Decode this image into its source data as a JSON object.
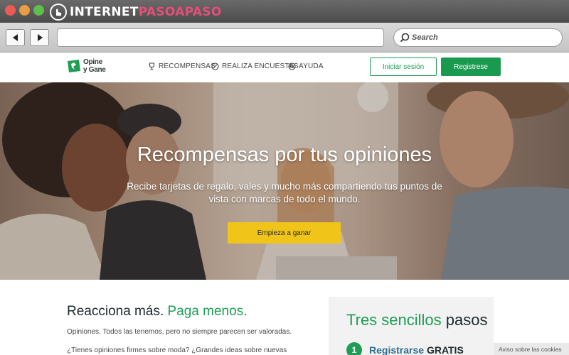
{
  "window": {
    "brand": {
      "prefix": "INTERNET",
      "accent": "PASOAPASO"
    }
  },
  "browser": {
    "url": "",
    "search_placeholder": "Search"
  },
  "site": {
    "logo": {
      "line1": "Opine",
      "line2": "y Gane"
    },
    "nav": [
      {
        "label": "RECOMPENSAS",
        "icon": "trophy-icon"
      },
      {
        "label": "REALIZA ENCUESTAS",
        "icon": "survey-icon"
      },
      {
        "label": "AYUDA",
        "icon": "help-icon"
      }
    ],
    "login_label": "Iniciar sesión",
    "register_label": "Registrese"
  },
  "hero": {
    "title": "Recompensas por tus opiniones",
    "subtitle": "Recibe tarjetas de regalo, vales y mucho más compartiendo tus puntos de vista con marcas de todo el mundo.",
    "cta": "Empieza a ganar"
  },
  "content": {
    "title_dark": "Reacciona más.",
    "title_green": "Paga menos.",
    "p1": "Opiniones. Todos las tenemos, pero no siempre parecen ser valoradas.",
    "p2": "¿Tienes opiniones firmes sobre moda? ¿Grandes ideas sobre nuevas"
  },
  "steps": {
    "title_green": "Tres sencillos",
    "title_dark": "pasos",
    "first": {
      "number": "1",
      "label": "Registrarse",
      "emphasis": "GRATIS"
    }
  },
  "cookie_notice": "Aviso sobre las cookies",
  "colors": {
    "brand_green": "#1f9d55",
    "cta_yellow": "#f0c419",
    "brand_pink": "#e44f7a",
    "step_blue": "#2d6f8f"
  }
}
